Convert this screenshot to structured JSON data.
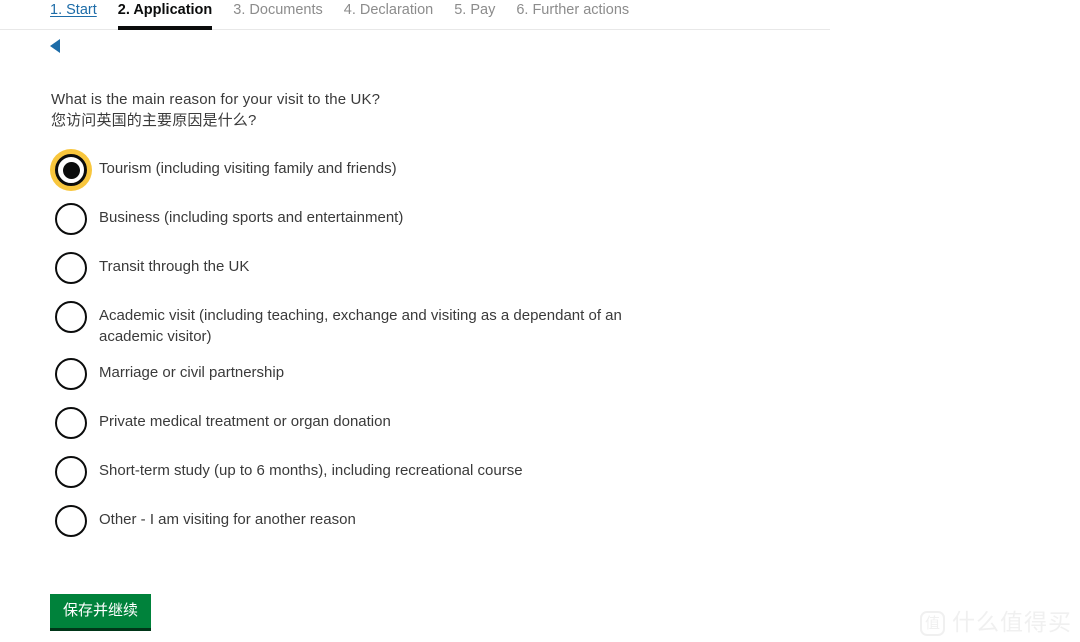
{
  "steps": [
    {
      "label": "1. Start",
      "state": "link"
    },
    {
      "label": "2. Application",
      "state": "active"
    },
    {
      "label": "3. Documents",
      "state": "inactive"
    },
    {
      "label": "4. Declaration",
      "state": "inactive"
    },
    {
      "label": "5. Pay",
      "state": "inactive"
    },
    {
      "label": "6. Further actions",
      "state": "inactive"
    }
  ],
  "back": {
    "icon": "back-triangle-icon"
  },
  "question": {
    "english": "What is the main reason for your visit to the UK?",
    "chinese": "您访问英国的主要原因是什么?"
  },
  "options": [
    {
      "label": "Tourism (including visiting family and friends)",
      "selected": true
    },
    {
      "label": "Business (including sports and entertainment)",
      "selected": false
    },
    {
      "label": "Transit through the UK",
      "selected": false
    },
    {
      "label": "Academic visit (including teaching, exchange and visiting as a dependant of an academic visitor)",
      "selected": false
    },
    {
      "label": "Marriage or civil partnership",
      "selected": false
    },
    {
      "label": "Private medical treatment or organ donation",
      "selected": false
    },
    {
      "label": "Short-term study (up to 6 months), including recreational course",
      "selected": false
    },
    {
      "label": "Other - I am visiting for another reason",
      "selected": false
    }
  ],
  "submit": {
    "label": "保存并继续"
  },
  "watermark": {
    "logo": "值",
    "text": "什么值得买"
  },
  "colors": {
    "link": "#1d6ca8",
    "active_text": "#0b0c0c",
    "inactive_text": "#8c8c8c",
    "focus_ring": "#f8c63d",
    "button_green": "#00823b",
    "body_text": "#3a3a3a"
  }
}
